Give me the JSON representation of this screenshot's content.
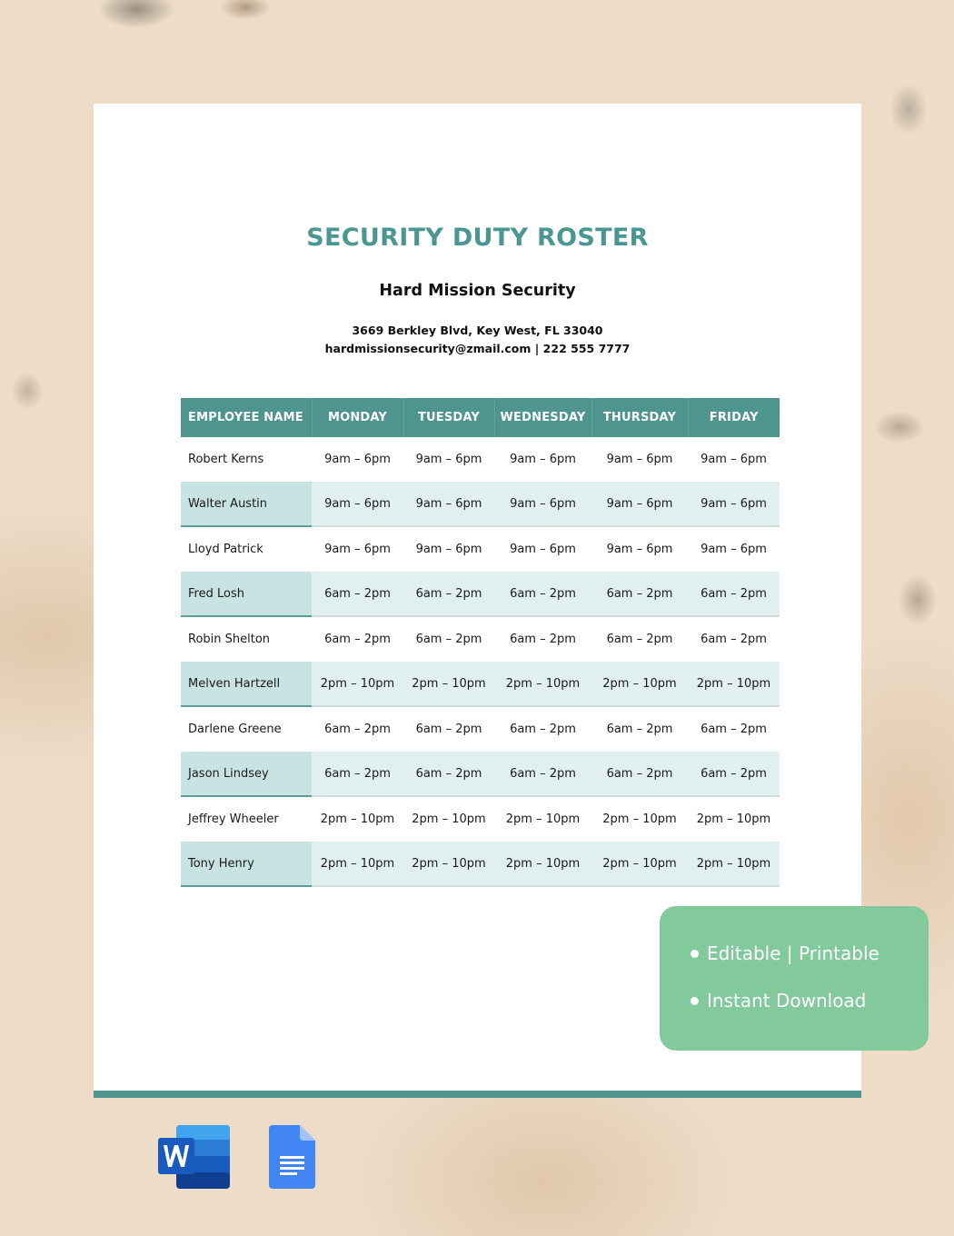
{
  "document": {
    "title": "SECURITY DUTY ROSTER",
    "company": "Hard Mission Security",
    "address": "3669 Berkley Blvd, Key West, FL 33040",
    "contact": "hardmissionsecurity@zmail.com | 222 555 7777"
  },
  "roster": {
    "headers": [
      "EMPLOYEE NAME",
      "MONDAY",
      "TUESDAY",
      "WEDNESDAY",
      "THURSDAY",
      "FRIDAY"
    ],
    "rows": [
      {
        "name": "Robert Kerns",
        "shifts": [
          "9am – 6pm",
          "9am – 6pm",
          "9am – 6pm",
          "9am – 6pm",
          "9am – 6pm"
        ]
      },
      {
        "name": "Walter Austin",
        "shifts": [
          "9am – 6pm",
          "9am – 6pm",
          "9am – 6pm",
          "9am – 6pm",
          "9am – 6pm"
        ]
      },
      {
        "name": "Lloyd Patrick",
        "shifts": [
          "9am – 6pm",
          "9am – 6pm",
          "9am – 6pm",
          "9am – 6pm",
          "9am – 6pm"
        ]
      },
      {
        "name": "Fred Losh",
        "shifts": [
          "6am – 2pm",
          "6am – 2pm",
          "6am – 2pm",
          "6am – 2pm",
          "6am – 2pm"
        ]
      },
      {
        "name": "Robin Shelton",
        "shifts": [
          "6am – 2pm",
          "6am – 2pm",
          "6am – 2pm",
          "6am – 2pm",
          "6am – 2pm"
        ]
      },
      {
        "name": "Melven Hartzell",
        "shifts": [
          "2pm – 10pm",
          "2pm – 10pm",
          "2pm – 10pm",
          "2pm – 10pm",
          "2pm – 10pm"
        ]
      },
      {
        "name": "Darlene Greene",
        "shifts": [
          "6am – 2pm",
          "6am – 2pm",
          "6am – 2pm",
          "6am – 2pm",
          "6am – 2pm"
        ]
      },
      {
        "name": "Jason Lindsey",
        "shifts": [
          "6am – 2pm",
          "6am – 2pm",
          "6am – 2pm",
          "6am – 2pm",
          "6am – 2pm"
        ]
      },
      {
        "name": "Jeffrey Wheeler",
        "shifts": [
          "2pm – 10pm",
          "2pm – 10pm",
          "2pm – 10pm",
          "2pm – 10pm",
          "2pm – 10pm"
        ]
      },
      {
        "name": "Tony Henry",
        "shifts": [
          "2pm – 10pm",
          "2pm – 10pm",
          "2pm – 10pm",
          "2pm – 10pm",
          "2pm – 10pm"
        ]
      }
    ]
  },
  "badge": {
    "features": [
      "Editable | Printable",
      "Instant Download"
    ]
  },
  "icons": {
    "word": "microsoft-word-icon",
    "docs": "google-docs-icon"
  },
  "colors": {
    "accent_teal": "#4e958f",
    "badge_green": "#82c99c"
  }
}
